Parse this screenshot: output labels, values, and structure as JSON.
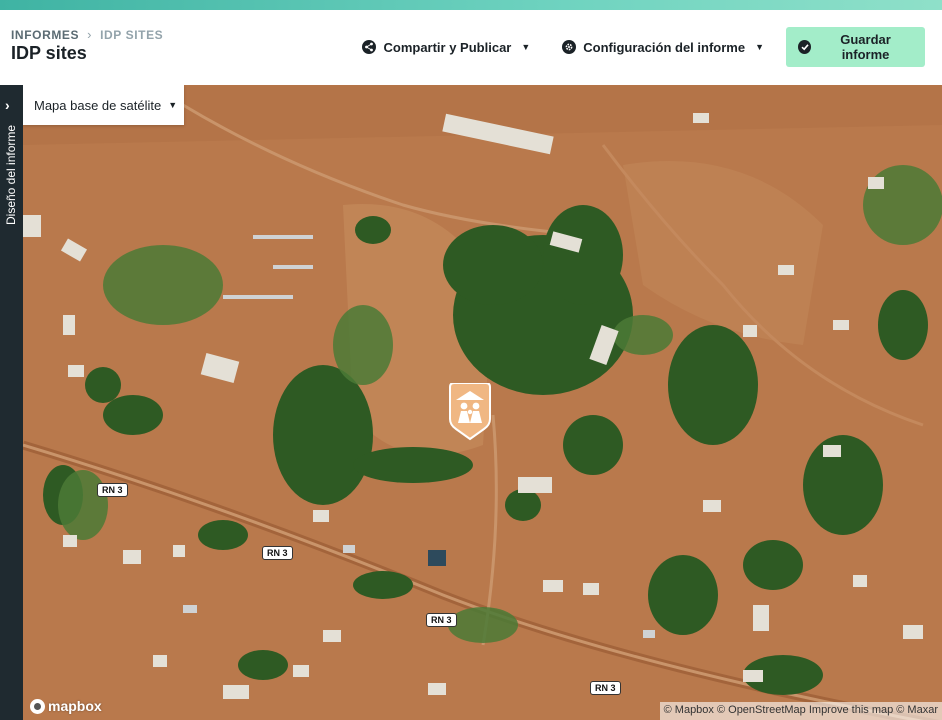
{
  "header": {
    "breadcrumb_root": "INFORMES",
    "breadcrumb_current": "IDP SITES",
    "title": "IDP sites",
    "share_label": "Compartir y Publicar",
    "config_label": "Configuración del informe",
    "save_label": "Guardar informe"
  },
  "sidebar": {
    "label": "Diseño del informe"
  },
  "map": {
    "basemap_label": "Mapa base de satélite",
    "logo_text": "mapbox",
    "attribution": "© Mapbox © OpenStreetMap Improve this map © Maxar",
    "road_labels": [
      "RN 3",
      "RN 3",
      "RN 3",
      "RN 3"
    ],
    "marker_icon": "people-icon",
    "colors": {
      "accent": "#a3edc9",
      "marker": "#f0b783",
      "rail": "#1f2a30"
    }
  }
}
